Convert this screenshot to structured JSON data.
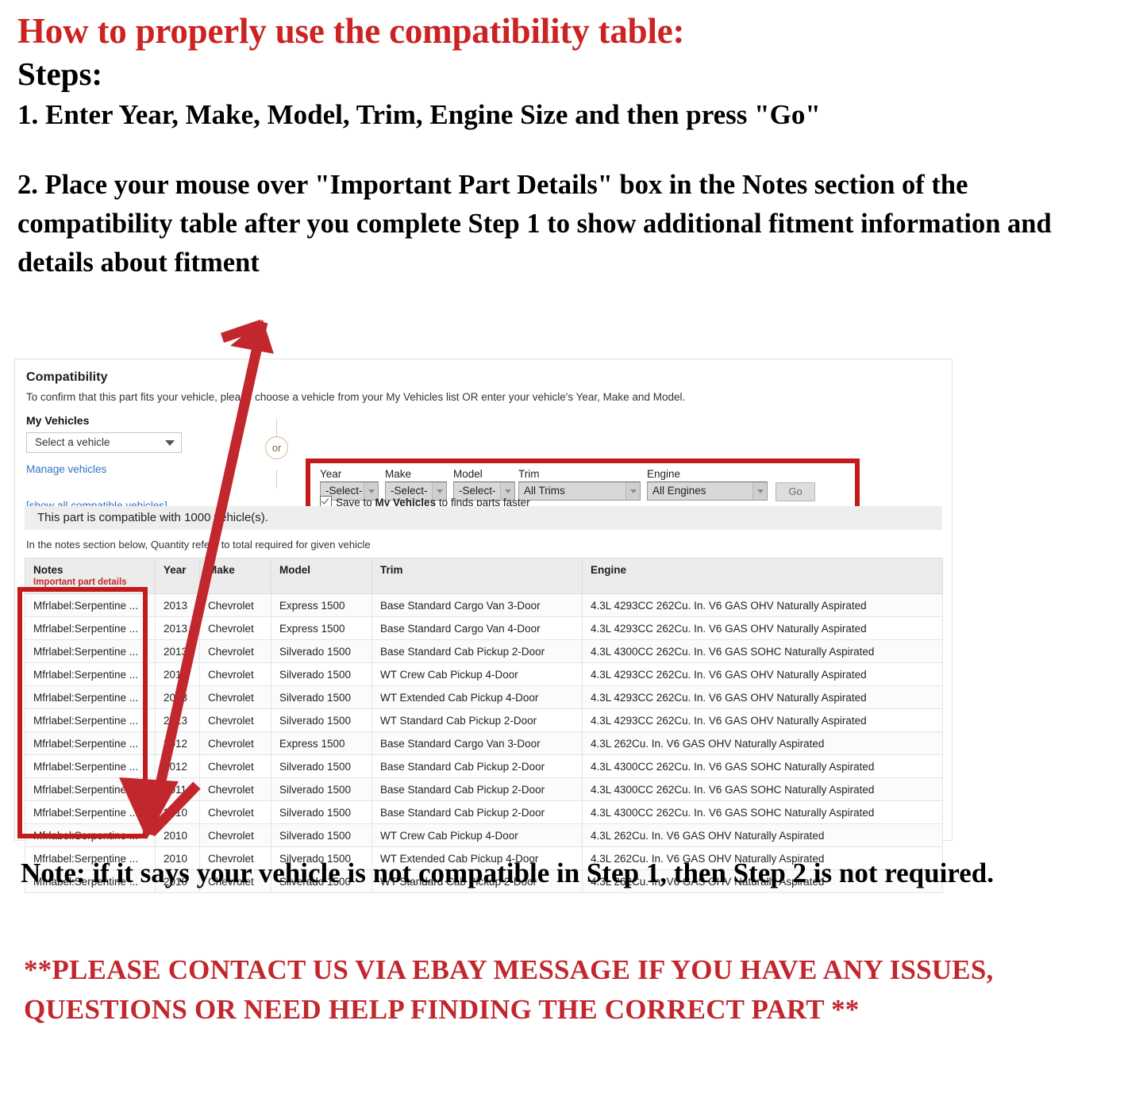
{
  "instructions": {
    "title": "How to properly use the compatibility table:",
    "steps_label": "Steps:",
    "step1": "1. Enter Year, Make, Model, Trim, Engine Size and then press \"Go\"",
    "step2": "2. Place your mouse over \"Important Part Details\" box in the Notes section of the compatibility table after you complete Step 1 to show additional fitment information and details about fitment"
  },
  "compatibility": {
    "heading": "Compatibility",
    "subtext": "To confirm that this part fits your vehicle, please choose a vehicle from your My Vehicles list OR enter your vehicle's Year, Make and Model.",
    "my_vehicles_label": "My Vehicles",
    "vehicle_select_value": "Select a vehicle",
    "manage_vehicles_link": "Manage vehicles",
    "show_all_link": "[show all compatible vehicles]",
    "or_badge": "or",
    "fields": [
      {
        "label": "Year",
        "value": "-Select-"
      },
      {
        "label": "Make",
        "value": "-Select-"
      },
      {
        "label": "Model",
        "value": "-Select-"
      },
      {
        "label": "Trim",
        "value": "All Trims"
      },
      {
        "label": "Engine",
        "value": "All Engines"
      }
    ],
    "go_button": "Go",
    "save_prefix": "Save to ",
    "save_bold": "My Vehicles",
    "save_suffix": " to finds parts faster",
    "banner": "This part is compatible with 1000 vehicle(s).",
    "notes_hint": "In the notes section below, Quantity refers to total required for given vehicle"
  },
  "table": {
    "headers": {
      "notes": "Notes",
      "notes_sub": "Important part details",
      "year": "Year",
      "make": "Make",
      "model": "Model",
      "trim": "Trim",
      "engine": "Engine"
    },
    "rows": [
      {
        "notes": "Mfrlabel:Serpentine ...",
        "year": "2013",
        "make": "Chevrolet",
        "model": "Express 1500",
        "trim": "Base Standard Cargo Van 3-Door",
        "engine": "4.3L 4293CC 262Cu. In. V6 GAS OHV Naturally Aspirated"
      },
      {
        "notes": "Mfrlabel:Serpentine ...",
        "year": "2013",
        "make": "Chevrolet",
        "model": "Express 1500",
        "trim": "Base Standard Cargo Van 4-Door",
        "engine": "4.3L 4293CC 262Cu. In. V6 GAS OHV Naturally Aspirated"
      },
      {
        "notes": "Mfrlabel:Serpentine ...",
        "year": "2013",
        "make": "Chevrolet",
        "model": "Silverado 1500",
        "trim": "Base Standard Cab Pickup 2-Door",
        "engine": "4.3L 4300CC 262Cu. In. V6 GAS SOHC Naturally Aspirated"
      },
      {
        "notes": "Mfrlabel:Serpentine ...",
        "year": "2013",
        "make": "Chevrolet",
        "model": "Silverado 1500",
        "trim": "WT Crew Cab Pickup 4-Door",
        "engine": "4.3L 4293CC 262Cu. In. V6 GAS OHV Naturally Aspirated"
      },
      {
        "notes": "Mfrlabel:Serpentine ...",
        "year": "2013",
        "make": "Chevrolet",
        "model": "Silverado 1500",
        "trim": "WT Extended Cab Pickup 4-Door",
        "engine": "4.3L 4293CC 262Cu. In. V6 GAS OHV Naturally Aspirated"
      },
      {
        "notes": "Mfrlabel:Serpentine ...",
        "year": "2013",
        "make": "Chevrolet",
        "model": "Silverado 1500",
        "trim": "WT Standard Cab Pickup 2-Door",
        "engine": "4.3L 4293CC 262Cu. In. V6 GAS OHV Naturally Aspirated"
      },
      {
        "notes": "Mfrlabel:Serpentine ...",
        "year": "2012",
        "make": "Chevrolet",
        "model": "Express 1500",
        "trim": "Base Standard Cargo Van 3-Door",
        "engine": "4.3L 262Cu. In. V6 GAS OHV Naturally Aspirated"
      },
      {
        "notes": "Mfrlabel:Serpentine ...",
        "year": "2012",
        "make": "Chevrolet",
        "model": "Silverado 1500",
        "trim": "Base Standard Cab Pickup 2-Door",
        "engine": "4.3L 4300CC 262Cu. In. V6 GAS SOHC Naturally Aspirated"
      },
      {
        "notes": "Mfrlabel:Serpentine ...",
        "year": "2011",
        "make": "Chevrolet",
        "model": "Silverado 1500",
        "trim": "Base Standard Cab Pickup 2-Door",
        "engine": "4.3L 4300CC 262Cu. In. V6 GAS SOHC Naturally Aspirated"
      },
      {
        "notes": "Mfrlabel:Serpentine ...",
        "year": "2010",
        "make": "Chevrolet",
        "model": "Silverado 1500",
        "trim": "Base Standard Cab Pickup 2-Door",
        "engine": "4.3L 4300CC 262Cu. In. V6 GAS SOHC Naturally Aspirated"
      },
      {
        "notes": "Mfrlabel:Serpentine ...",
        "year": "2010",
        "make": "Chevrolet",
        "model": "Silverado 1500",
        "trim": "WT Crew Cab Pickup 4-Door",
        "engine": "4.3L 262Cu. In. V6 GAS OHV Naturally Aspirated"
      },
      {
        "notes": "Mfrlabel:Serpentine ...",
        "year": "2010",
        "make": "Chevrolet",
        "model": "Silverado 1500",
        "trim": "WT Extended Cab Pickup 4-Door",
        "engine": "4.3L 262Cu. In. V6 GAS OHV Naturally Aspirated"
      },
      {
        "notes": "Mfrlabel:Serpentine ...",
        "year": "2010",
        "make": "Chevrolet",
        "model": "Silverado 1500",
        "trim": "WT Standard Cab Pickup 2-Door",
        "engine": "4.3L 262Cu. In. V6 GAS OHV Naturally Aspirated"
      }
    ]
  },
  "footer": {
    "note": "Note: if it says your vehicle is not compatible in Step 1, then Step 2 is not required.",
    "contact": "**PLEASE CONTACT US VIA EBAY MESSAGE IF YOU HAVE ANY ISSUES, QUESTIONS OR NEED HELP FINDING THE CORRECT PART **"
  },
  "colors": {
    "title_red": "#cc2222",
    "highlight_red": "#c11b1b",
    "link_blue": "#3272c4",
    "notes_red": "#c1272d"
  }
}
